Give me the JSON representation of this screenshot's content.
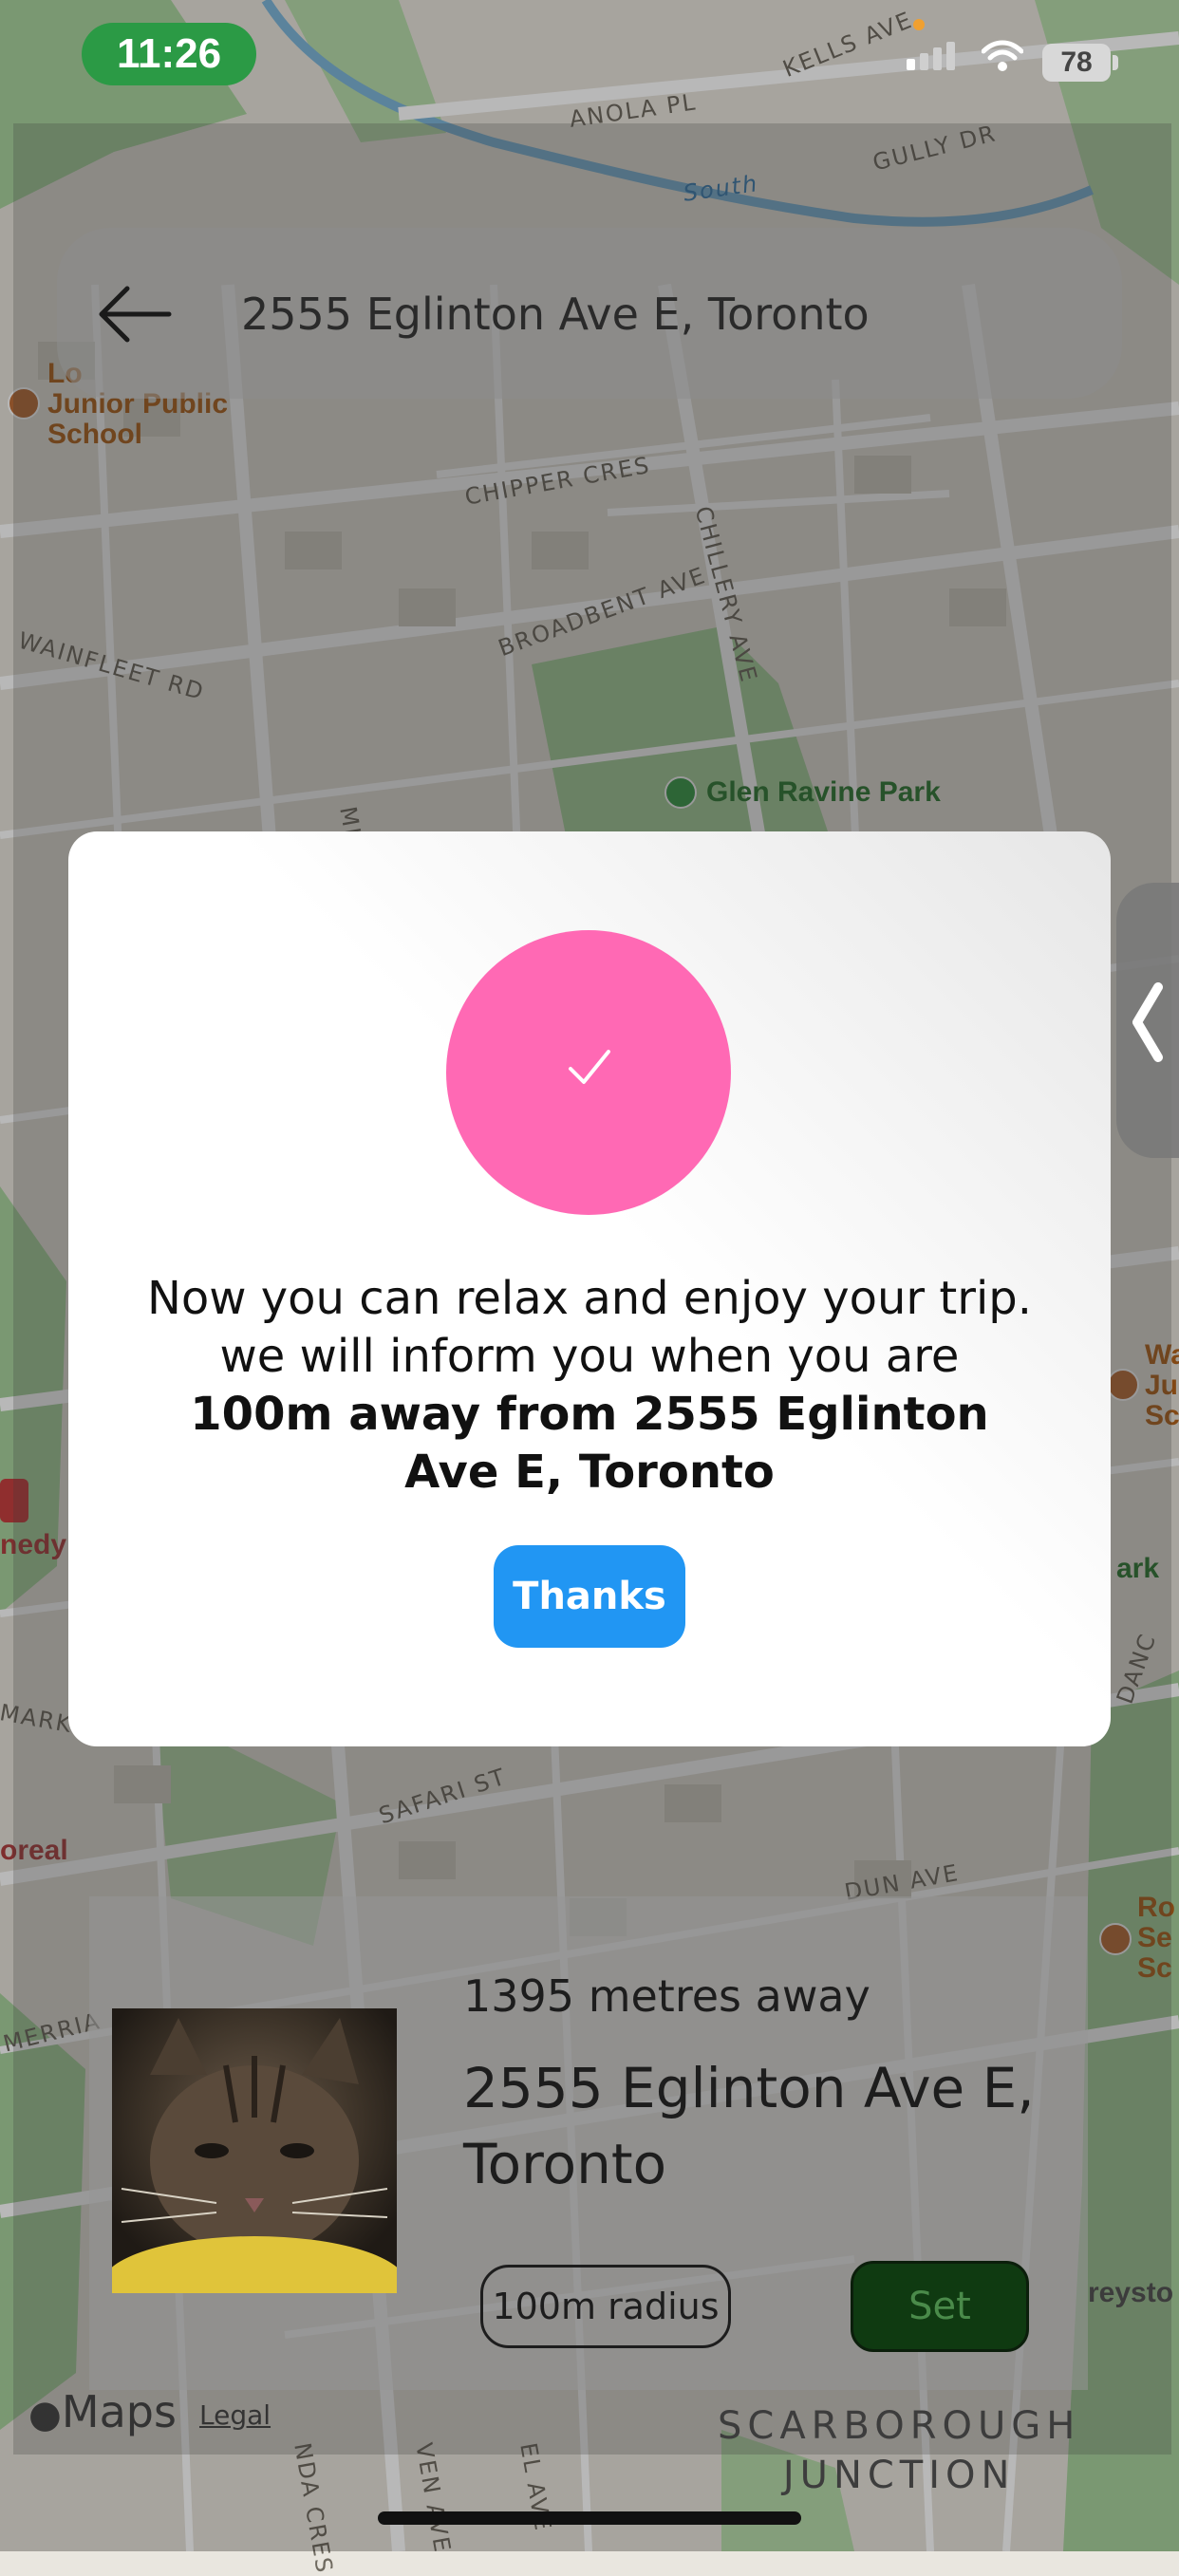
{
  "status_bar": {
    "time": "11:26",
    "battery": "78",
    "accent_color": "#2b9a45"
  },
  "search": {
    "back_icon": "arrow-left-icon",
    "address": "2555 Eglinton Ave E, Toronto"
  },
  "map": {
    "street_labels": [
      "KELLS AVE",
      "ANOLA PL",
      "GULLY DR",
      "CHIPPER CRES",
      "BROADBENT AVE",
      "CHILLERY AVE",
      "WAINFLEET RD",
      "MID",
      "MARK",
      "SAFARI ST",
      "DUN AVE",
      "MERRIA",
      "NDA CRES",
      "VEN AVE",
      "EL AVE",
      "DANC"
    ],
    "water_label": "South",
    "poi_labels": {
      "school_top": "Lo\nJunior Public\nSchool",
      "school_right": "Wa\nJu\nSc",
      "school_bottom_right": "Ro\nSe\nSc",
      "left_mid": "nedy",
      "left_bottom": "oreal",
      "right_park": "ark",
      "right_bottom": "reysto"
    },
    "park_label": "Glen Ravine Park",
    "area_label": "SCARBOROUGH\nJUNCTION",
    "brand": "Maps",
    "legal": "Legal"
  },
  "modal": {
    "check_icon": "checkmark-icon",
    "circle_color": "#ff69b4",
    "message_line1": "Now you can relax and enjoy your trip.",
    "message_line2": "we will inform you when you are ",
    "message_bold": "100m away from 2555 Eglinton Ave E, Toronto",
    "thanks_label": "Thanks",
    "button_color": "#2196f3"
  },
  "card": {
    "distance": "1395 metres away",
    "address": "2555 Eglinton Ave E, Toronto",
    "radius_chip": "100m radius",
    "set_label": "Set"
  }
}
